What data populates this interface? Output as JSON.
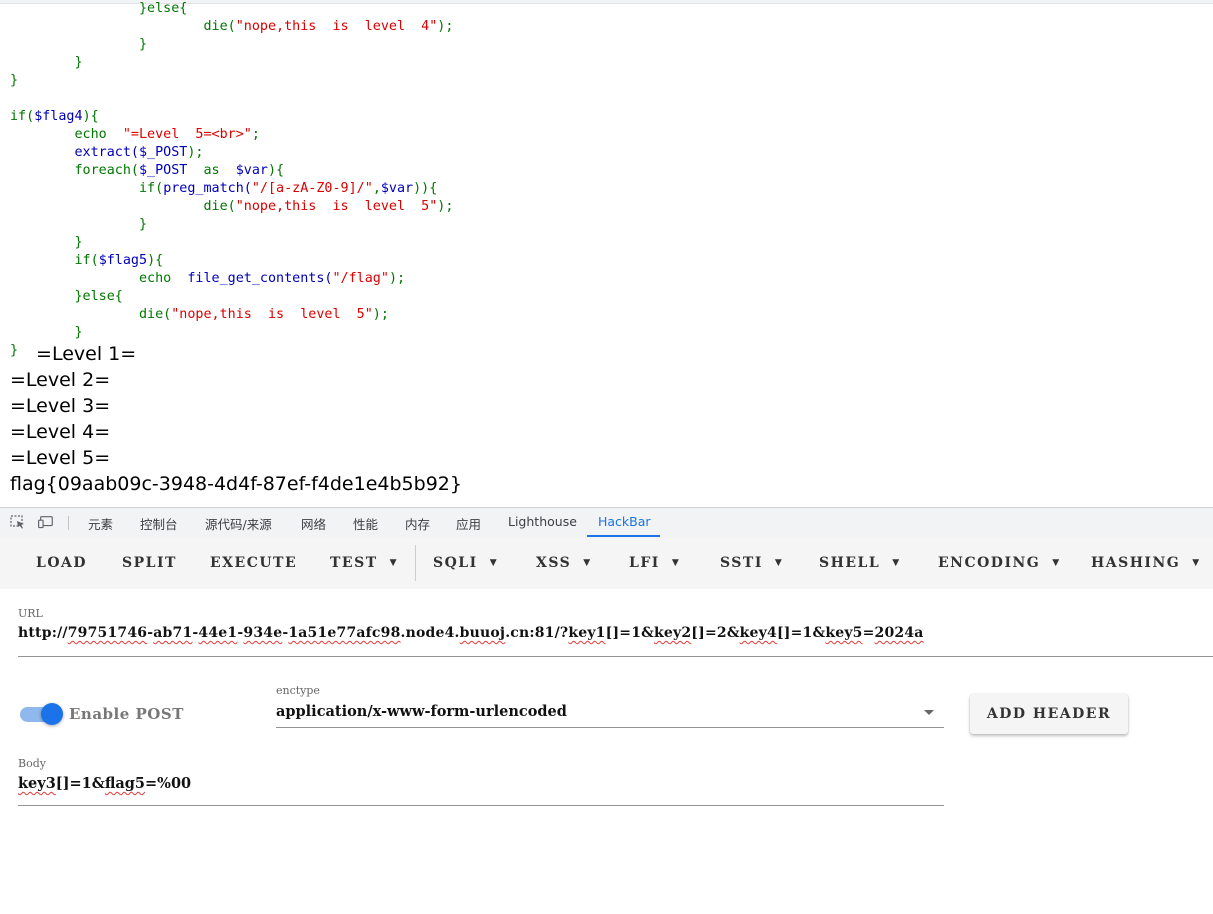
{
  "code_lines": [
    {
      "indent": "                ",
      "parts": [
        {
          "t": "}else{",
          "c": "kw"
        }
      ]
    },
    {
      "indent": "                        ",
      "parts": [
        {
          "t": "die(",
          "c": "kw"
        },
        {
          "t": "\"nope,this  is  level  4\"",
          "c": "st"
        },
        {
          "t": ");",
          "c": "kw"
        }
      ]
    },
    {
      "indent": "                ",
      "parts": [
        {
          "t": "}",
          "c": "kw"
        }
      ]
    },
    {
      "indent": "        ",
      "parts": [
        {
          "t": "}",
          "c": "kw"
        }
      ]
    },
    {
      "indent": "",
      "parts": [
        {
          "t": "}",
          "c": "kw"
        }
      ]
    },
    {
      "indent": "",
      "parts": []
    },
    {
      "indent": "",
      "parts": [
        {
          "t": "if(",
          "c": "kw"
        },
        {
          "t": "$flag4",
          "c": "vr"
        },
        {
          "t": "){",
          "c": "kw"
        }
      ]
    },
    {
      "indent": "        ",
      "parts": [
        {
          "t": "echo  ",
          "c": "kw"
        },
        {
          "t": "\"=Level  5=<br>\"",
          "c": "st"
        },
        {
          "t": ";",
          "c": "kw"
        }
      ]
    },
    {
      "indent": "        ",
      "parts": [
        {
          "t": "extract(",
          "c": "vr"
        },
        {
          "t": "$_POST",
          "c": "vr"
        },
        {
          "t": ");",
          "c": "kw"
        }
      ]
    },
    {
      "indent": "        ",
      "parts": [
        {
          "t": "foreach(",
          "c": "kw"
        },
        {
          "t": "$_POST  ",
          "c": "vr"
        },
        {
          "t": "as  ",
          "c": "kw"
        },
        {
          "t": "$var",
          "c": "vr"
        },
        {
          "t": "){",
          "c": "kw"
        }
      ]
    },
    {
      "indent": "                ",
      "parts": [
        {
          "t": "if(",
          "c": "kw"
        },
        {
          "t": "preg_match(",
          "c": "vr"
        },
        {
          "t": "\"/[a-zA-Z0-9]/\"",
          "c": "st"
        },
        {
          "t": ",",
          "c": "kw"
        },
        {
          "t": "$var",
          "c": "vr"
        },
        {
          "t": ")){",
          "c": "kw"
        }
      ]
    },
    {
      "indent": "                        ",
      "parts": [
        {
          "t": "die(",
          "c": "kw"
        },
        {
          "t": "\"nope,this  is  level  5\"",
          "c": "st"
        },
        {
          "t": ");",
          "c": "kw"
        }
      ]
    },
    {
      "indent": "                ",
      "parts": [
        {
          "t": "}",
          "c": "kw"
        }
      ]
    },
    {
      "indent": "        ",
      "parts": [
        {
          "t": "}",
          "c": "kw"
        }
      ]
    },
    {
      "indent": "        ",
      "parts": [
        {
          "t": "if(",
          "c": "kw"
        },
        {
          "t": "$flag5",
          "c": "vr"
        },
        {
          "t": "){",
          "c": "kw"
        }
      ]
    },
    {
      "indent": "                ",
      "parts": [
        {
          "t": "echo  ",
          "c": "kw"
        },
        {
          "t": "file_get_contents(",
          "c": "vr"
        },
        {
          "t": "\"/flag\"",
          "c": "st"
        },
        {
          "t": ");",
          "c": "kw"
        }
      ]
    },
    {
      "indent": "        ",
      "parts": [
        {
          "t": "}else{",
          "c": "kw"
        }
      ]
    },
    {
      "indent": "                ",
      "parts": [
        {
          "t": "die(",
          "c": "kw"
        },
        {
          "t": "\"nope,this  is  level  5\"",
          "c": "st"
        },
        {
          "t": ");",
          "c": "kw"
        }
      ]
    },
    {
      "indent": "        ",
      "parts": [
        {
          "t": "}",
          "c": "kw"
        }
      ]
    },
    {
      "indent": "",
      "parts": [
        {
          "t": "}",
          "c": "kw"
        }
      ]
    }
  ],
  "output_lines": [
    " =Level 1=",
    "=Level 2=",
    "=Level 3=",
    "=Level 4=",
    "=Level 5=",
    "flag{09aab09c-3948-4d4f-87ef-f4de1e4b5b92}"
  ],
  "devtools": {
    "tabs": [
      "元素",
      "控制台",
      "源代码/来源",
      "网络",
      "性能",
      "内存",
      "应用",
      "Lighthouse",
      "HackBar"
    ],
    "active_tab": "HackBar",
    "accent_color": "#1a73e8"
  },
  "hackbar": {
    "buttons": [
      {
        "label": "LOAD",
        "dropdown": false
      },
      {
        "label": "SPLIT",
        "dropdown": false
      },
      {
        "label": "EXECUTE",
        "dropdown": false
      },
      {
        "label": "TEST",
        "dropdown": true
      },
      {
        "label": "SQLI",
        "dropdown": true
      },
      {
        "label": "XSS",
        "dropdown": true
      },
      {
        "label": "LFI",
        "dropdown": true
      },
      {
        "label": "SSTI",
        "dropdown": true
      },
      {
        "label": "SHELL",
        "dropdown": true
      },
      {
        "label": "ENCODING",
        "dropdown": true
      },
      {
        "label": "HASHING",
        "dropdown": true
      }
    ],
    "url_label": "URL",
    "url_value": "http://79751746-ab71-44e1-934e-1a51e77afc98.node4.buuoj.cn:81/?key1[]=1&key2[]=2&key4[]=1&key5=2024a",
    "enable_post_label": "Enable POST",
    "enable_post_on": true,
    "enctype_label": "enctype",
    "enctype_value": "application/x-www-form-urlencoded",
    "add_header_label": "ADD HEADER",
    "body_label": "Body",
    "body_value": "key3[]=1&flag5=%00"
  }
}
